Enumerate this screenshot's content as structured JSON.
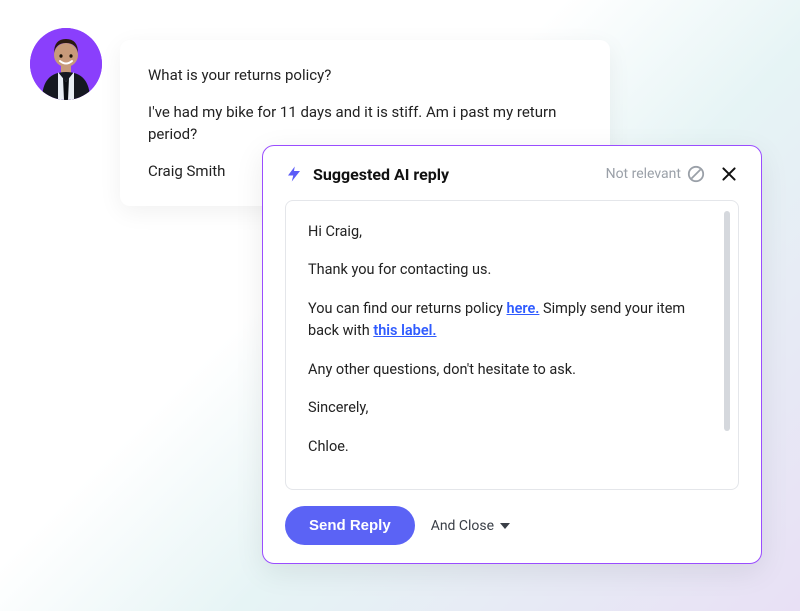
{
  "customer": {
    "avatar_name": "customer-avatar"
  },
  "message": {
    "line1": "What is your returns policy?",
    "line2": "I've had my bike for 11 days and it is stiff. Am i past my return period?",
    "signature": "Craig Smith"
  },
  "reply_panel": {
    "title": "Suggested AI reply",
    "not_relevant_label": "Not relevant",
    "body": {
      "greeting": "Hi Craig,",
      "thanks": "Thank you for contacting us.",
      "policy_pre": "You can find our returns policy ",
      "policy_link": "here.",
      "policy_mid": " Simply send your item back with ",
      "label_link": "this label.",
      "questions": "Any other questions, don't hesitate to ask.",
      "signoff": "Sincerely,",
      "name": "Chloe."
    },
    "send_label": "Send Reply",
    "and_close_label": "And Close"
  }
}
